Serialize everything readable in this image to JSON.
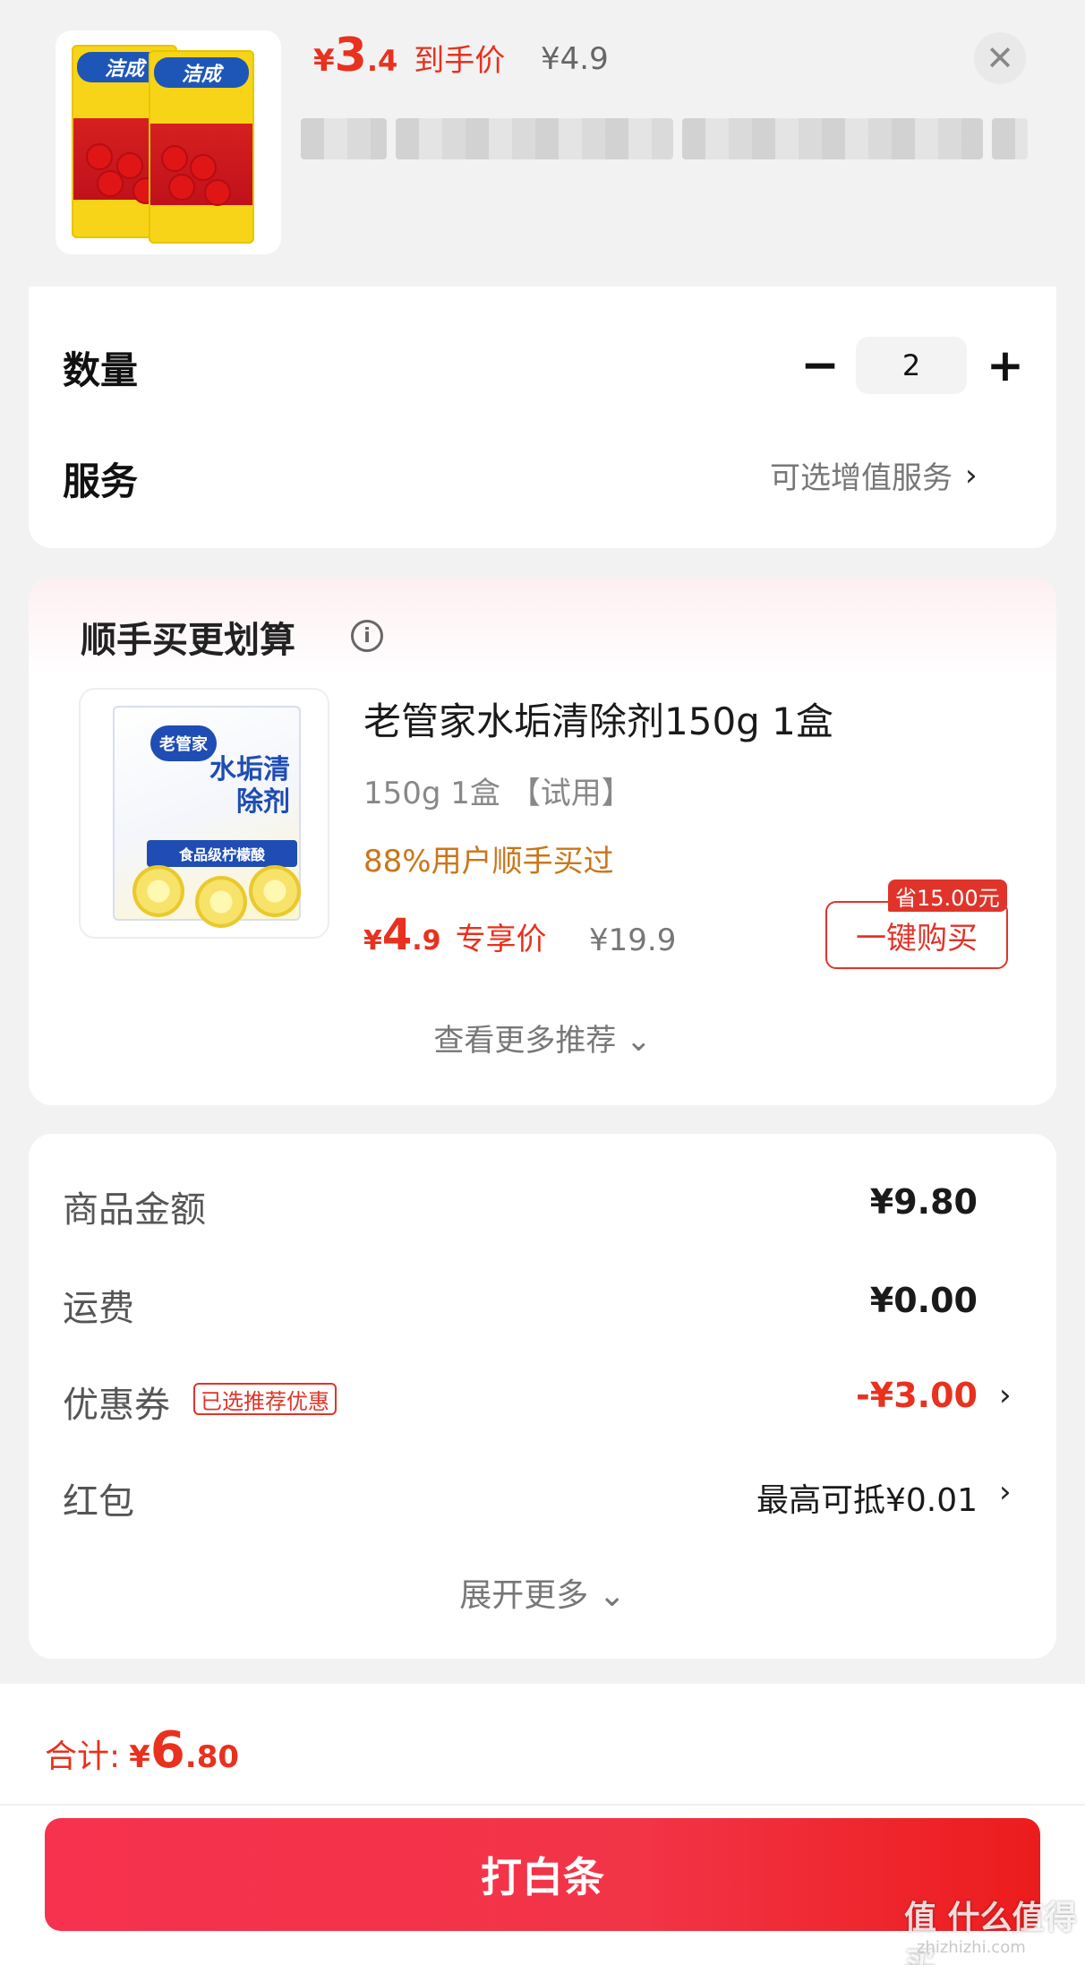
{
  "header": {
    "price_currency": "¥",
    "price_int": "3",
    "price_dec": ".4",
    "price_tag": "到手价",
    "original_price": "¥4.9",
    "close_symbol": "✕",
    "product_bag_brand": "洁成"
  },
  "order": {
    "quantity_label": "数量",
    "quantity_value": "2",
    "minus_symbol": "−",
    "plus_symbol": "+",
    "service_label": "服务",
    "service_value": "可选增值服务",
    "chevron": "›"
  },
  "recommend": {
    "title": "顺手买更划算",
    "info_symbol": "i",
    "product_name": "老管家水垢清除剂150g 1盒",
    "spec": "150g 1盒 【试用】",
    "bought_text": "88%用户顺手买过",
    "price_currency": "¥",
    "price_int": "4",
    "price_dec": ".9",
    "price_tag": "专享价",
    "original_price": "¥19.9",
    "save_badge": "省15.00元",
    "buy_label": "一键购买",
    "more_label": "查看更多推荐 ⌄",
    "box_logo": "老管家",
    "box_name": "水垢清除剂",
    "box_band": "食品级柠檬酸"
  },
  "summary": {
    "rows": [
      {
        "label": "商品金额",
        "value": "¥9.80"
      },
      {
        "label": "运费",
        "value": "¥0.00"
      },
      {
        "label": "优惠券",
        "badge": "已选推荐优惠",
        "value": "-¥3.00"
      },
      {
        "label": "红包",
        "value": "最高可抵¥0.01"
      }
    ],
    "expand_label": "展开更多 ⌄"
  },
  "footer": {
    "total_label": "合计:",
    "total_currency": "¥",
    "total_int": "6",
    "total_dec": ".80",
    "pay_label": "打白条",
    "watermark": "值 什么值得买",
    "watermark_sub": "zhizhizhi.com"
  },
  "colors": {
    "accent_red": "#e8311e",
    "bought_orange": "#c9761a",
    "background": "#f2f2f2"
  }
}
